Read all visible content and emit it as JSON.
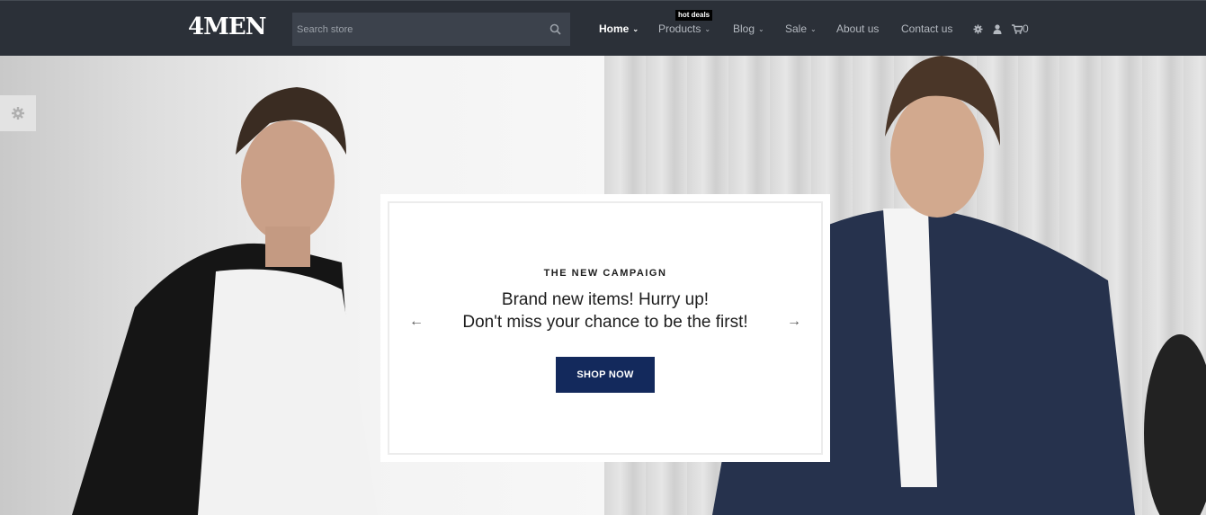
{
  "header": {
    "logo": "4MEN",
    "search": {
      "placeholder": "Search store",
      "icon": "search-icon"
    },
    "nav": [
      {
        "label": "Home",
        "caret": "⌄"
      },
      {
        "label": "Products",
        "caret": "⌄",
        "badge": "hot deals"
      },
      {
        "label": "Blog",
        "caret": "⌄"
      },
      {
        "label": "Sale",
        "caret": "⌄"
      },
      {
        "label": "About us"
      },
      {
        "label": "Contact us"
      }
    ],
    "icons": [
      "gear-icon",
      "user-icon",
      "cart-icon"
    ],
    "cart_count": "0"
  },
  "slider": {
    "kicker": "THE NEW CAMPAIGN",
    "headline_line1": "Brand new items! Hurry up!",
    "headline_line2": "Don't miss your chance to be the first!",
    "prev_arrow": "←",
    "next_arrow": "→",
    "cta": "SHOP NOW"
  },
  "colors": {
    "header_bg": "#2b3038",
    "search_bg": "#3c424c",
    "cta_bg": "#13295c",
    "nav_active": "#ffffff",
    "nav_text": "#b4b9c0"
  }
}
